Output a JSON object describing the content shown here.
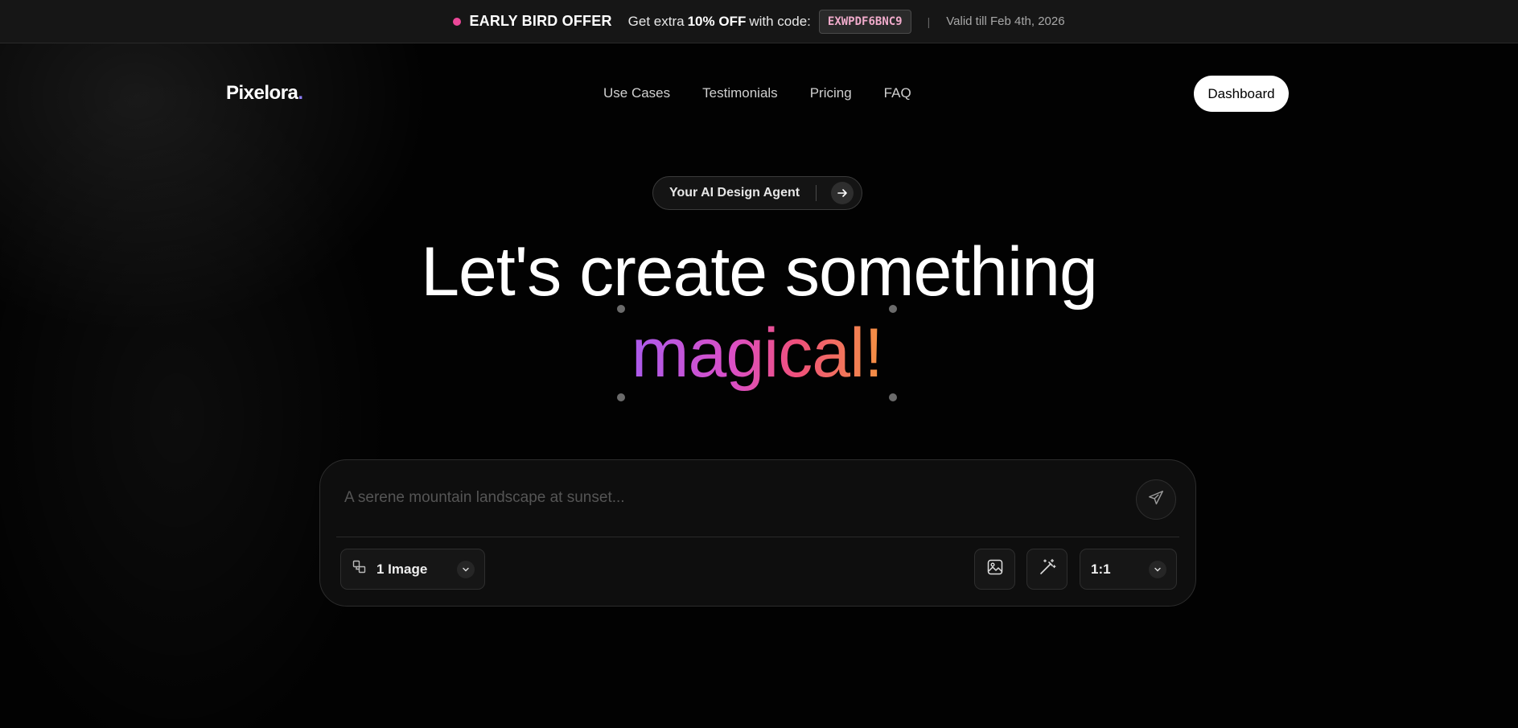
{
  "banner": {
    "offer_label": "EARLY BIRD OFFER",
    "text_pre": "Get extra",
    "discount": "10% OFF",
    "text_post": "with code:",
    "code": "EXWPDF6BNC9",
    "separator": "|",
    "validity": "Valid till Feb 4th, 2026",
    "dot_color": "#ec4899"
  },
  "header": {
    "logo_text": "Pixelora",
    "logo_dot": ".",
    "nav": [
      {
        "label": "Use Cases"
      },
      {
        "label": "Testimonials"
      },
      {
        "label": "Pricing"
      },
      {
        "label": "FAQ"
      }
    ],
    "dashboard_label": "Dashboard"
  },
  "hero": {
    "pill_label": "Your AI Design Agent",
    "headline_line1": "Let's create something",
    "headline_highlight": "magical!",
    "gradient_colors": [
      "#a65cf0",
      "#d94fc8",
      "#f0507a",
      "#f59a3a"
    ]
  },
  "prompt": {
    "placeholder": "A serene mountain landscape at sunset...",
    "value": "",
    "image_count_label": "1 Image",
    "aspect_ratio": "1:1",
    "icons": [
      "layers-icon",
      "send-icon",
      "chevron-down-icon",
      "image-icon",
      "magic-wand-icon"
    ]
  }
}
